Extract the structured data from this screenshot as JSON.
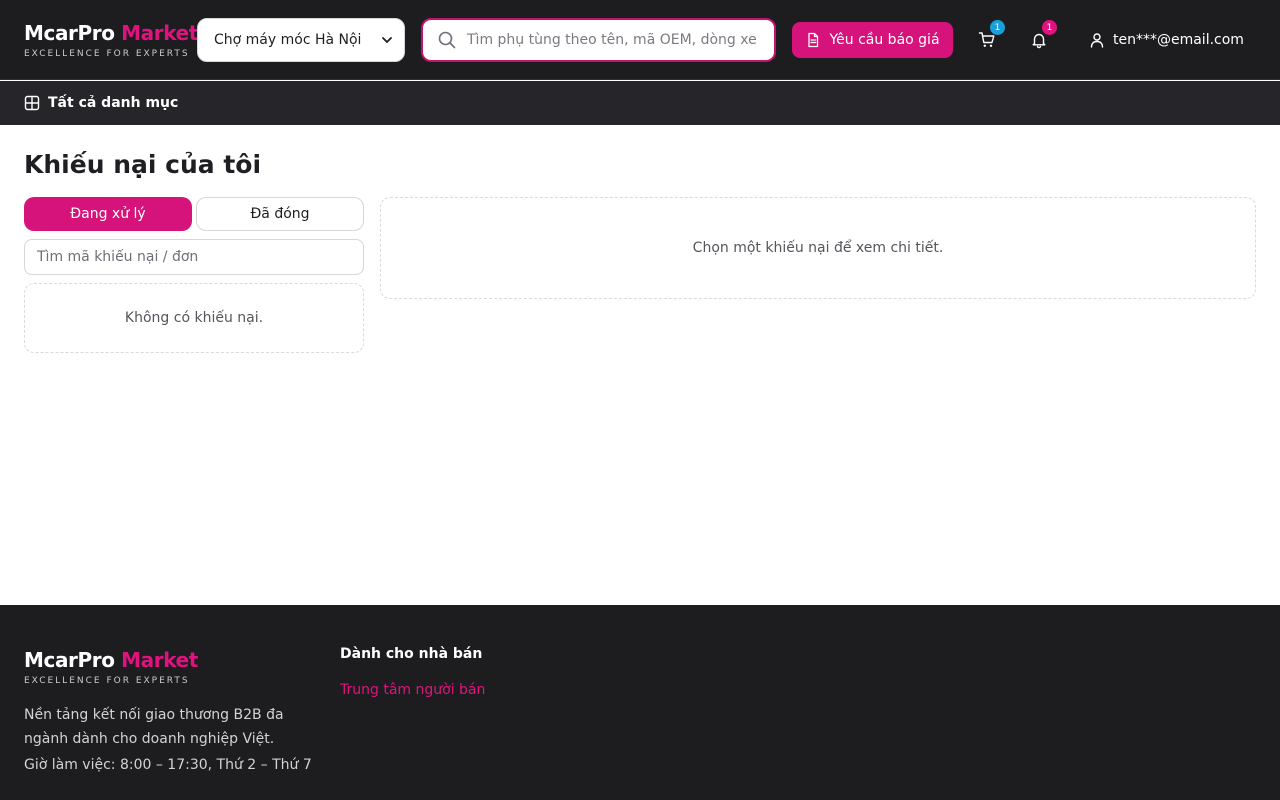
{
  "brand": {
    "name_part1": "McarPro",
    "name_part2": "Market",
    "tagline": "EXCELLENCE FOR EXPERTS",
    "accent_color": "#e0137e"
  },
  "header": {
    "market_select": {
      "selected": "Chợ máy móc Hà Nội",
      "icon": "chevron-down-icon"
    },
    "search": {
      "placeholder": "Tìm phụ tùng theo tên, mã OEM, dòng xe...",
      "value": "",
      "icon": "search-icon"
    },
    "quote_button": {
      "label": "Yêu cầu báo giá",
      "icon": "document-icon"
    },
    "cart": {
      "icon": "cart-icon",
      "badge": "1",
      "badge_color": "#1a9fd8"
    },
    "notifications": {
      "icon": "bell-icon",
      "badge": "1",
      "badge_color": "#e0137e"
    },
    "account": {
      "label": "ten***@email.com",
      "icon": "user-icon"
    }
  },
  "category_bar": {
    "label": "Tất cả danh mục",
    "icon": "grid-icon"
  },
  "main": {
    "title": "Khiếu nại của tôi",
    "tabs": [
      {
        "label": "Đang xử lý",
        "active": true
      },
      {
        "label": "Đã đóng",
        "active": false
      }
    ],
    "search": {
      "placeholder": "Tìm mã khiếu nại / đơn",
      "value": ""
    },
    "empty_list_text": "Không có khiếu nại.",
    "detail_placeholder": "Chọn một khiếu nại để xem chi tiết."
  },
  "footer": {
    "description": "Nền tảng kết nối giao thương B2B đa ngành dành cho doanh nghiệp Việt.",
    "hours": "Giờ làm việc: 8:00 – 17:30, Thứ 2 – Thứ 7",
    "seller_column": {
      "title": "Dành cho nhà bán",
      "links": [
        "Trung tâm người bán"
      ]
    }
  }
}
